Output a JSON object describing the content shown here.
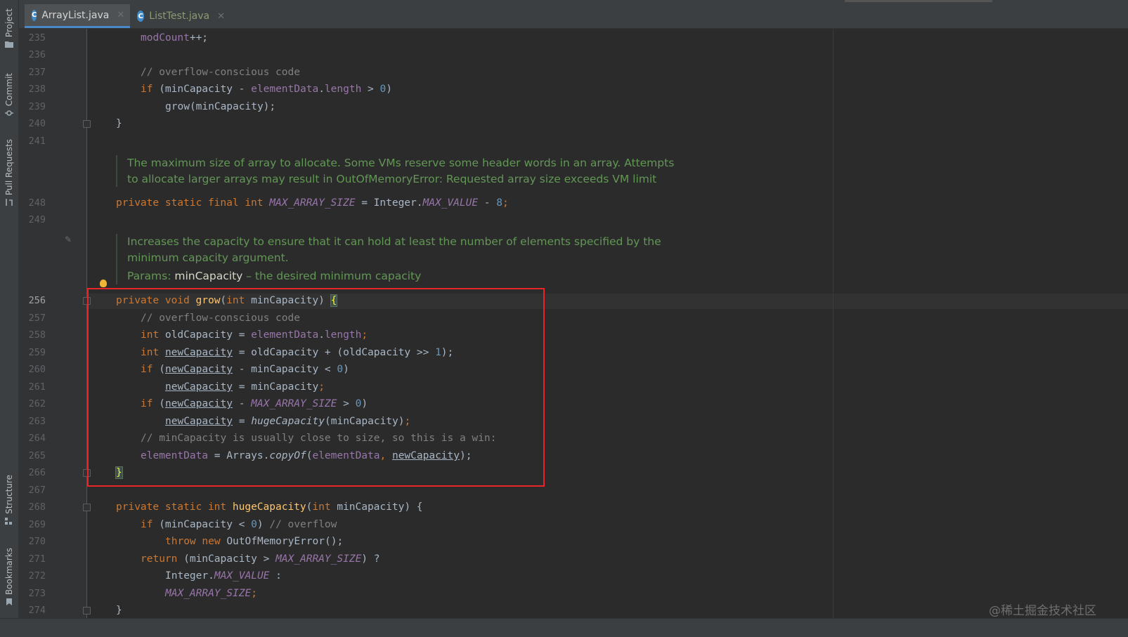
{
  "tool_strip": {
    "project": "Project",
    "commit": "Commit",
    "pull_requests": "Pull Requests",
    "structure": "Structure",
    "bookmarks": "Bookmarks"
  },
  "tabs": [
    {
      "label": "ArrayList.java",
      "active": true,
      "icon": "java-class-icon"
    },
    {
      "label": "ListTest.java",
      "active": false,
      "icon": "java-class-icon"
    }
  ],
  "line_numbers": [
    "235",
    "236",
    "237",
    "238",
    "239",
    "240",
    "241",
    "248",
    "249",
    "256",
    "257",
    "258",
    "259",
    "260",
    "261",
    "262",
    "263",
    "264",
    "265",
    "266",
    "267",
    "268",
    "269",
    "270",
    "271",
    "272",
    "273",
    "274"
  ],
  "code": {
    "l235_a": "modCount",
    "l235_b": "++;",
    "l237": "// overflow-conscious code",
    "l238_a": "if",
    "l238_b": " (minCapacity - ",
    "l238_c": "elementData",
    "l238_d": ".",
    "l238_e": "length",
    "l238_f": " > ",
    "l238_g": "0",
    "l238_h": ")",
    "l239": "grow(minCapacity);",
    "l240": "}",
    "l248_a": "private static final int ",
    "l248_b": "MAX_ARRAY_SIZE",
    "l248_c": " = Integer.",
    "l248_d": "MAX_VALUE",
    "l248_e": " - ",
    "l248_f": "8",
    "l248_g": ";",
    "l256_a": "private void ",
    "l256_b": "grow",
    "l256_c": "(",
    "l256_d": "int",
    "l256_e": " minCapacity) ",
    "l256_f": "{",
    "l257": "// overflow-conscious code",
    "l258_a": "int",
    "l258_b": " oldCapacity = ",
    "l258_c": "elementData",
    "l258_d": ".",
    "l258_e": "length",
    "l258_f": ";",
    "l259_a": "int",
    "l259_b": "newCapacity",
    "l259_c": " = oldCapacity + (oldCapacity >> ",
    "l259_d": "1",
    "l259_e": ");",
    "l260_a": "if",
    "l260_b": " (",
    "l260_c": "newCapacity",
    "l260_d": " - minCapacity < ",
    "l260_e": "0",
    "l260_f": ")",
    "l261_a": "newCapacity",
    "l261_b": " = minCapacity",
    "l261_c": ";",
    "l262_a": "if",
    "l262_b": " (",
    "l262_c": "newCapacity",
    "l262_d": " - ",
    "l262_e": "MAX_ARRAY_SIZE",
    "l262_f": " > ",
    "l262_g": "0",
    "l262_h": ")",
    "l263_a": "newCapacity",
    "l263_b": " = ",
    "l263_c": "hugeCapacity",
    "l263_d": "(minCapacity)",
    "l263_e": ";",
    "l264": "// minCapacity is usually close to size, so this is a win:",
    "l265_a": "elementData",
    "l265_b": " = Arrays.",
    "l265_c": "copyOf",
    "l265_d": "(",
    "l265_e": "elementData",
    "l265_f": ", ",
    "l265_g": "newCapacity",
    "l265_h": ");",
    "l266": "}",
    "l268_a": "private static int ",
    "l268_b": "hugeCapacity",
    "l268_c": "(",
    "l268_d": "int",
    "l268_e": " minCapacity) {",
    "l269_a": "if",
    "l269_b": " (minCapacity < ",
    "l269_c": "0",
    "l269_d": ") ",
    "l269_e": "// overflow",
    "l270_a": "throw new ",
    "l270_b": "OutOfMemoryError();",
    "l271_a": "return",
    "l271_b": " (minCapacity > ",
    "l271_c": "MAX_ARRAY_SIZE",
    "l271_d": ") ?",
    "l272_a": "Integer.",
    "l272_b": "MAX_VALUE",
    "l272_c": " :",
    "l273_a": "MAX_ARRAY_SIZE",
    "l273_b": ";",
    "l274": "}"
  },
  "docs": {
    "max_size_line1": "The maximum size of array to allocate. Some VMs reserve some header words in an array. Attempts",
    "max_size_line2": "to allocate larger arrays may result in OutOfMemoryError: Requested array size exceeds VM limit",
    "grow_line1": "Increases the capacity to ensure that it can hold at least the number of elements specified by the",
    "grow_line2": "minimum capacity argument.",
    "grow_params_label": "Params:",
    "grow_params_name": "minCapacity",
    "grow_params_desc": " – the desired minimum capacity"
  },
  "watermark": "@稀土掘金技术社区",
  "colors": {
    "highlight_box": "#e8262a",
    "keyword": "#cc7832",
    "field": "#9876aa",
    "doc": "#629755",
    "number": "#6897bb"
  }
}
